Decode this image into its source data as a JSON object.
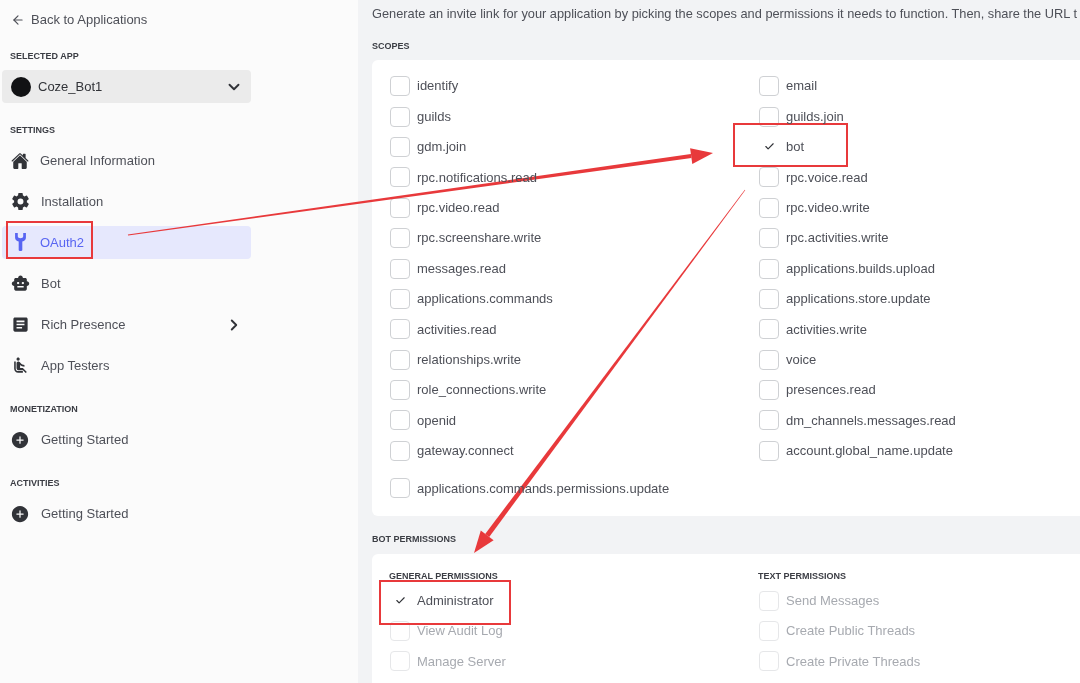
{
  "sidebar": {
    "back_link": "Back to Applications",
    "selected_app": {
      "heading": "SELECTED APP",
      "name": "Coze_Bot1"
    },
    "sections": [
      {
        "heading": "SETTINGS",
        "items": [
          {
            "label": "General Information",
            "kind": "page",
            "selected": false
          },
          {
            "label": "Installation",
            "kind": "page",
            "selected": false
          },
          {
            "label": "OAuth2",
            "kind": "page",
            "selected": true
          },
          {
            "label": "Bot",
            "kind": "page",
            "selected": false
          },
          {
            "label": "Rich Presence",
            "kind": "group",
            "selected": false
          },
          {
            "label": "App Testers",
            "kind": "page",
            "selected": false
          }
        ]
      },
      {
        "heading": "MONETIZATION",
        "items": [
          {
            "label": "Getting Started",
            "kind": "page",
            "selected": false
          }
        ]
      },
      {
        "heading": "ACTIVITIES",
        "items": [
          {
            "label": "Getting Started",
            "kind": "page",
            "selected": false
          }
        ]
      }
    ]
  },
  "intro": "Generate an invite link for your application by picking the scopes and permissions it needs to function. Then, share the URL t",
  "scopes": {
    "heading": "SCOPES",
    "items": [
      {
        "label": "identify",
        "checked": false
      },
      {
        "label": "email",
        "checked": false
      },
      {
        "label": "guilds",
        "checked": false
      },
      {
        "label": "guilds.join",
        "checked": false
      },
      {
        "label": "gdm.join",
        "checked": false
      },
      {
        "label": "bot",
        "checked": true
      },
      {
        "label": "rpc.notifications.read",
        "checked": false
      },
      {
        "label": "rpc.voice.read",
        "checked": false
      },
      {
        "label": "rpc.video.read",
        "checked": false
      },
      {
        "label": "rpc.video.write",
        "checked": false
      },
      {
        "label": "rpc.screenshare.write",
        "checked": false
      },
      {
        "label": "rpc.activities.write",
        "checked": false
      },
      {
        "label": "messages.read",
        "checked": false
      },
      {
        "label": "applications.builds.upload",
        "checked": false
      },
      {
        "label": "applications.commands",
        "checked": false
      },
      {
        "label": "applications.store.update",
        "checked": false
      },
      {
        "label": "activities.read",
        "checked": false
      },
      {
        "label": "activities.write",
        "checked": false
      },
      {
        "label": "relationships.write",
        "checked": false
      },
      {
        "label": "voice",
        "checked": false
      },
      {
        "label": "role_connections.write",
        "checked": false
      },
      {
        "label": "presences.read",
        "checked": false
      },
      {
        "label": "openid",
        "checked": false
      },
      {
        "label": "dm_channels.messages.read",
        "checked": false
      },
      {
        "label": "gateway.connect",
        "checked": false
      },
      {
        "label": "account.global_name.update",
        "checked": false
      },
      {
        "label": "applications.commands.permissions.update",
        "checked": false
      }
    ]
  },
  "bot_permissions": {
    "heading": "BOT PERMISSIONS",
    "groups": [
      {
        "heading": "GENERAL PERMISSIONS",
        "items": [
          {
            "label": "Administrator",
            "checked": true,
            "disabled": false
          },
          {
            "label": "View Audit Log",
            "checked": false,
            "disabled": true
          },
          {
            "label": "Manage Server",
            "checked": false,
            "disabled": true
          }
        ]
      },
      {
        "heading": "TEXT PERMISSIONS",
        "items": [
          {
            "label": "Send Messages",
            "checked": false,
            "disabled": true
          },
          {
            "label": "Create Public Threads",
            "checked": false,
            "disabled": true
          },
          {
            "label": "Create Private Threads",
            "checked": false,
            "disabled": true
          }
        ]
      }
    ]
  }
}
